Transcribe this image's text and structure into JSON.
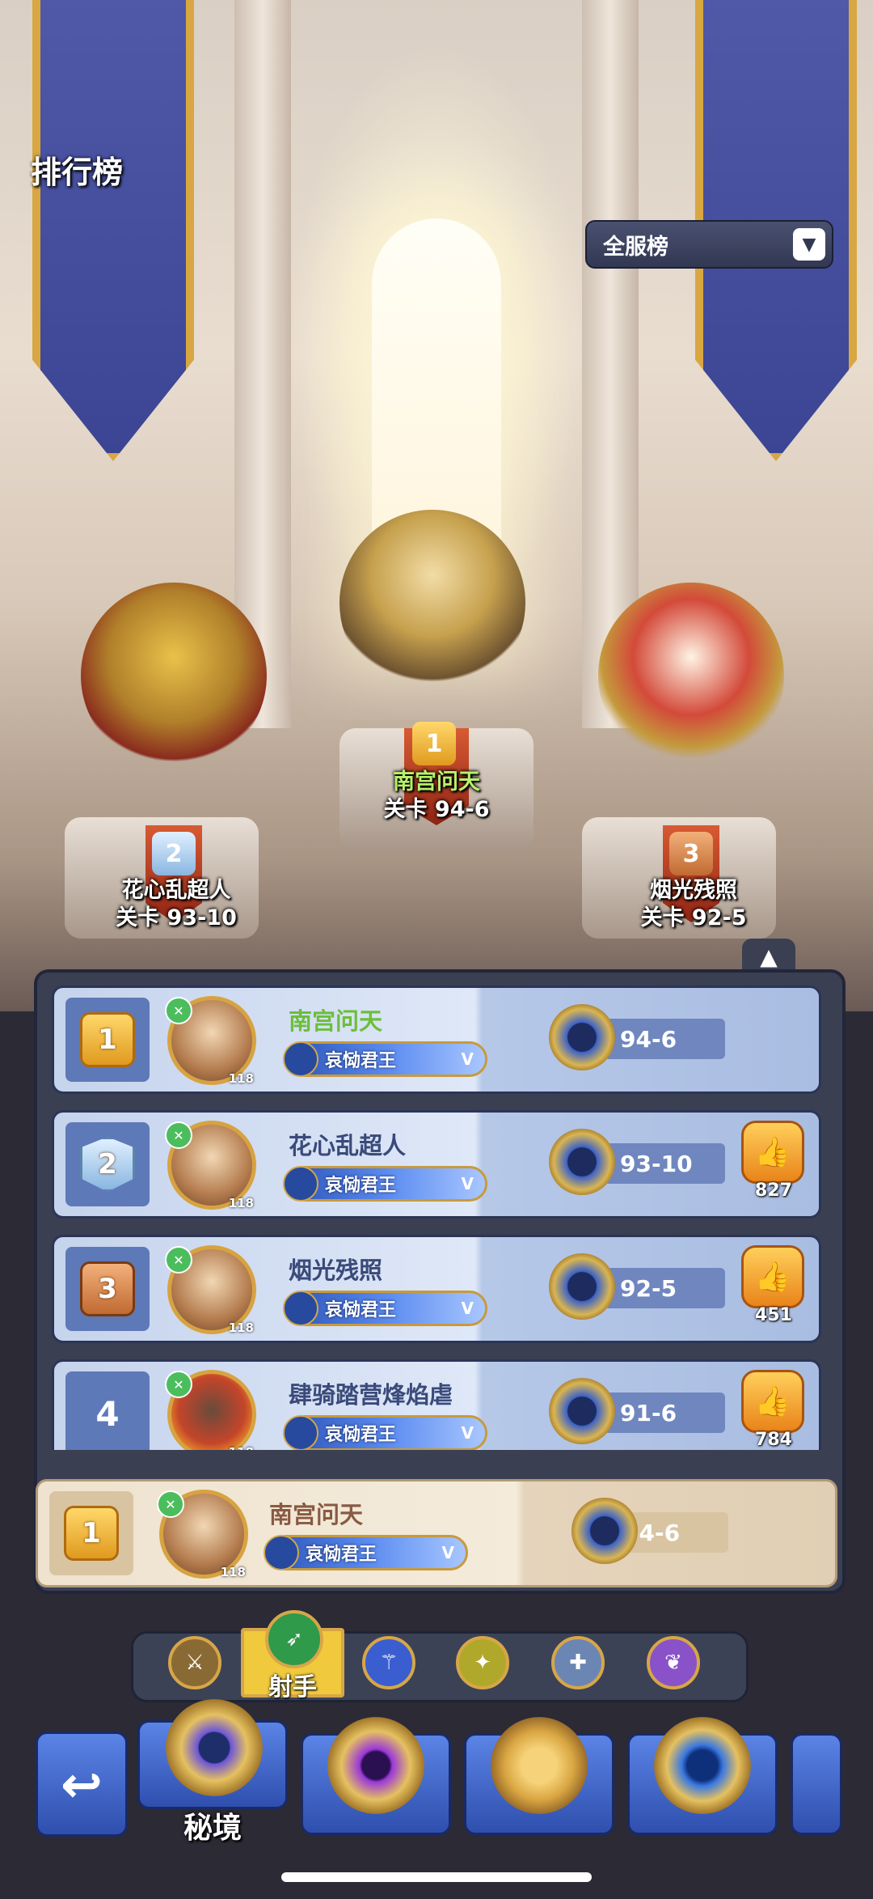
{
  "header": {
    "title": "排行榜"
  },
  "scope_dropdown": {
    "selected": "全服榜",
    "arrow": "▼"
  },
  "podium": [
    {
      "rank": "1",
      "name": "南宫问天",
      "stage": "关卡 94-6"
    },
    {
      "rank": "2",
      "name": "花心乱超人",
      "stage": "关卡 93-10"
    },
    {
      "rank": "3",
      "name": "烟光残照",
      "stage": "关卡 92-5"
    }
  ],
  "collapse_icon": "▲",
  "leaderboard": [
    {
      "rank": "1",
      "medal": "gold",
      "name": "南宫问天",
      "level": "118",
      "title": "哀恸君王",
      "title_tier": "V",
      "stage": "94-6",
      "likes": null,
      "is_me": true
    },
    {
      "rank": "2",
      "medal": "silver",
      "name": "花心乱超人",
      "level": "118",
      "title": "哀恸君王",
      "title_tier": "V",
      "stage": "93-10",
      "likes": "827",
      "is_me": false
    },
    {
      "rank": "3",
      "medal": "bronze",
      "name": "烟光残照",
      "level": "118",
      "title": "哀恸君王",
      "title_tier": "V",
      "stage": "92-5",
      "likes": "451",
      "is_me": false
    },
    {
      "rank": "4",
      "medal": "none",
      "name": "肆骑踏营烽焰虐",
      "level": "118",
      "title": "哀恸君王",
      "title_tier": "V",
      "stage": "91-6",
      "likes": "784",
      "is_me": false
    }
  ],
  "my_entry": {
    "rank": "1",
    "name": "南宫问天",
    "level": "118",
    "title": "哀恸君王",
    "title_tier": "V",
    "stage": "94-6"
  },
  "class_tabs": {
    "selected_label": "射手",
    "icons": [
      "axe-warrior-icon",
      "bow-archer-icon",
      "staff-mage-icon",
      "blade-assassin-icon",
      "cross-priest-icon",
      "wing-support-icon"
    ]
  },
  "bottom_nav": {
    "back_glyph": "↩",
    "active_label": "秘境"
  },
  "colors": {
    "accent_gold": "#f1c93c",
    "panel_dark": "#3a3f52",
    "row_blue": "#c5d3ec",
    "my_row": "#efe3cf"
  }
}
